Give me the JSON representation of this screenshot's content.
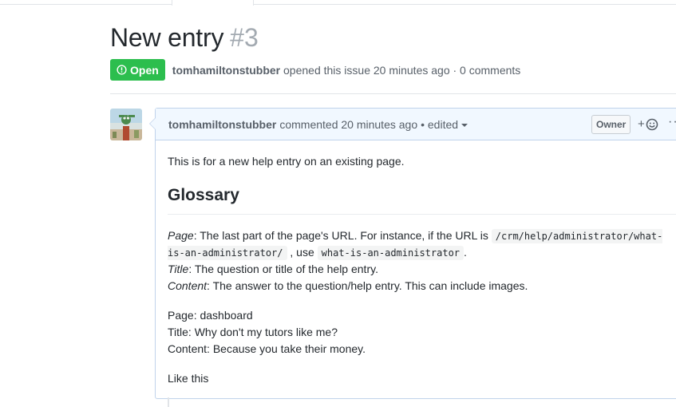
{
  "issue": {
    "title": "New entry",
    "number": "#3",
    "state": "Open",
    "author": "tomhamiltonstubber",
    "opened_text": "opened this issue 20 minutes ago · 0 comments"
  },
  "comment": {
    "author": "tomhamiltonstubber",
    "commented_text": "commented 20 minutes ago",
    "edited_text": "• edited",
    "owner_label": "Owner",
    "react_plus": "+",
    "more": "···",
    "intro": "This is for a new help entry on an existing page.",
    "heading": "Glossary",
    "glossary": {
      "page_term": "Page",
      "page_desc_1": ": The last part of the page's URL. For instance, if the URL is",
      "page_code_1": "/crm/help/administrator/what-is-an-administrator/",
      "page_desc_2": ", use",
      "page_code_2": "what-is-an-administrator",
      "page_desc_3": ".",
      "title_term": "Title",
      "title_desc": ": The question or title of the help entry.",
      "content_term": "Content",
      "content_desc": ": The answer to the question/help entry. This can include images."
    },
    "example": {
      "line1": "Page: dashboard",
      "line2": "Title: Why don't my tutors like me?",
      "line3": "Content: Because you take their money."
    },
    "outro": "Like this"
  },
  "colors": {
    "open_green": "#2cbe4e",
    "header_blue": "#f1f8ff",
    "border_blue": "#c0d3eb"
  },
  "icons": [
    "issue-opened-icon",
    "smiley-icon",
    "caret-down-icon",
    "kebab-icon",
    "avatar"
  ]
}
